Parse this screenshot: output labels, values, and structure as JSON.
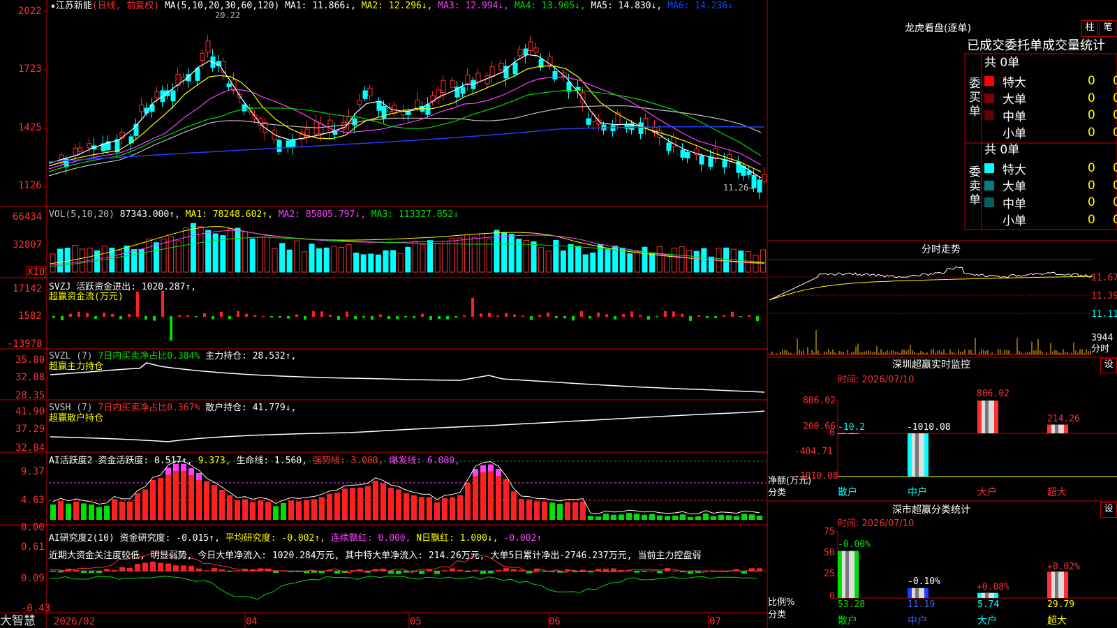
{
  "header": {
    "star": "★",
    "stock_name": "江苏新能",
    "period_info": "(日线, 前复权)",
    "ma_prefix": "MA(5,10,20,30,60,120)",
    "ma1": "MA1: 11.866↓,",
    "ma2": "MA2: 12.296↓,",
    "ma3": "MA3: 12.994↓,",
    "ma4": "MA4: 13.905↓,",
    "ma5": "MA5: 14.830↓,",
    "ma6": "MA6: 14.236↓",
    "high_marker": "20.22",
    "low_marker": "11.26→"
  },
  "price_axis": [
    "2022",
    "1723",
    "1425",
    "1126"
  ],
  "vol_panel": {
    "axis": [
      "66434",
      "32807",
      "X10"
    ],
    "title": "VOL(5,10,20)",
    "v": "87343.000↑,",
    "ma1": "MA1: 78248.602↑,",
    "ma2": "MA2: 85805.797↓,",
    "ma3": "MA3: 113327.852↓"
  },
  "svzj_panel": {
    "axis": [
      "17142",
      "1582",
      "-13978"
    ],
    "title": "SVZJ  活跃资金进出: 1020.287↑,",
    "subtitle": "超赢资金流(万元)"
  },
  "svzl_panel": {
    "axis": [
      "35.80",
      "32.08",
      "28.35"
    ],
    "title_prefix": "SVZL (7)",
    "ratio": "7日内买卖净占比0.384%",
    "holding": "主力持仓: 28.532↑,",
    "subtitle": "超赢主力持仓"
  },
  "svsh_panel": {
    "axis": [
      "41.90",
      "37.29",
      "32.84"
    ],
    "title_prefix": "SVSH (7)",
    "ratio": "7日内买卖净占比0.367%",
    "holding": "散户持仓: 41.779↓,",
    "subtitle": "超赢散户持仓"
  },
  "ai_active_panel": {
    "axis": [
      "9.37",
      "4.63",
      "0.00"
    ],
    "title": "AI活跃度2",
    "activity": "资金活跃度: 0.517↑,",
    "v2": "9.373,",
    "life": "生命线: 1.560,",
    "strong": "强势线: 3.000,",
    "burst": "爆发线: 6.000,"
  },
  "ai_research_panel": {
    "axis": [
      "0.61",
      "0.09",
      "-0.43"
    ],
    "title": "AI研究度2(10)",
    "research": "资金研究度: -0.015↑,",
    "avg": "平均研究度: -0.002↑,",
    "cont": "连续飘红: 0.000,",
    "nday": "N日飘红: 1.000↓,",
    "last": "-0.002↑",
    "comment": "近期大资金关注度较低, 明显弱势, 今日大单净流入: 1020.284万元, 其中特大单净流入: 214.26万元, 大单5日累计净出-2746.237万元, 当前主力控盘弱"
  },
  "footer": {
    "brand": "大智慧",
    "dates": [
      "2026/02",
      "04",
      "05",
      "06",
      "07"
    ]
  },
  "right": {
    "dragon_title": "龙虎看盘(逐单)",
    "btn_bar": "柱",
    "btn_pen": "笔",
    "stats_title": "已成交委托单成交量统计",
    "buy_label": "委买单",
    "sell_label": "委卖单",
    "buy_total": "共 0单",
    "sell_total": "共 0单",
    "buy_rows": [
      {
        "name": "特大",
        "count": "0",
        "pct": "0%",
        "color": "#ff0000"
      },
      {
        "name": "大单",
        "count": "0",
        "pct": "0%",
        "color": "#800000"
      },
      {
        "name": "中单",
        "count": "0",
        "pct": "0%",
        "color": "#600000"
      },
      {
        "name": "小单",
        "count": "0",
        "pct": "0%",
        "color": "#000000"
      }
    ],
    "sell_rows": [
      {
        "name": "特大",
        "count": "0",
        "pct": "0%",
        "color": "#00ffff"
      },
      {
        "name": "大单",
        "count": "0",
        "pct": "0%",
        "color": "#008080"
      },
      {
        "name": "中单",
        "count": "0",
        "pct": "0%",
        "color": "#006060"
      },
      {
        "name": "小单",
        "count": "0",
        "pct": "0%",
        "color": "#000000"
      }
    ],
    "intraday_title": "分时走势",
    "intraday_axis": [
      "11.67",
      "11.39",
      "11.11",
      "3944",
      "分时"
    ],
    "monitor_title": "深圳超赢实时监控",
    "monitor_btn": "设",
    "monitor_time": "时间: 2026/07/10",
    "monitor_axis": [
      "806.02",
      "200.66",
      "0",
      "-404.71",
      "-1010.08"
    ],
    "monitor_ylabel": "净额(万元)",
    "monitor_xlabel": "分类",
    "monitor_cats": [
      "散户",
      "中户",
      "大户",
      "超大"
    ],
    "monitor_values_text": [
      "-10.2",
      "-1010.08",
      "806.02",
      "214.26"
    ],
    "class_title": "深市超赢分类统计",
    "class_btn": "设",
    "class_time": "时间: 2026/07/10",
    "class_axis": [
      "75",
      "50",
      "25",
      "0"
    ],
    "class_ylabel": "比例%",
    "class_xlabel": "分类",
    "class_cats": [
      "散户",
      "中户",
      "大户",
      "超大"
    ],
    "class_change": [
      "-0.00%",
      "-0.10%",
      "+0.08%",
      "+0.02%"
    ],
    "class_values_text": [
      "53.28",
      "11.19",
      "5.74",
      "29.79"
    ]
  },
  "chart_data": [
    {
      "type": "bar",
      "title": "深圳超赢实时监控",
      "ylabel": "净额(万元)",
      "categories": [
        "散户",
        "中户",
        "大户",
        "超大"
      ],
      "values": [
        -10.2,
        -1010.08,
        806.02,
        214.26
      ],
      "ylim": [
        -1010.08,
        806.02
      ]
    },
    {
      "type": "bar",
      "title": "深市超赢分类统计",
      "ylabel": "比例%",
      "categories": [
        "散户",
        "中户",
        "大户",
        "超大"
      ],
      "values": [
        53.28,
        11.19,
        5.74,
        29.79
      ],
      "ylim": [
        0,
        75
      ]
    }
  ]
}
